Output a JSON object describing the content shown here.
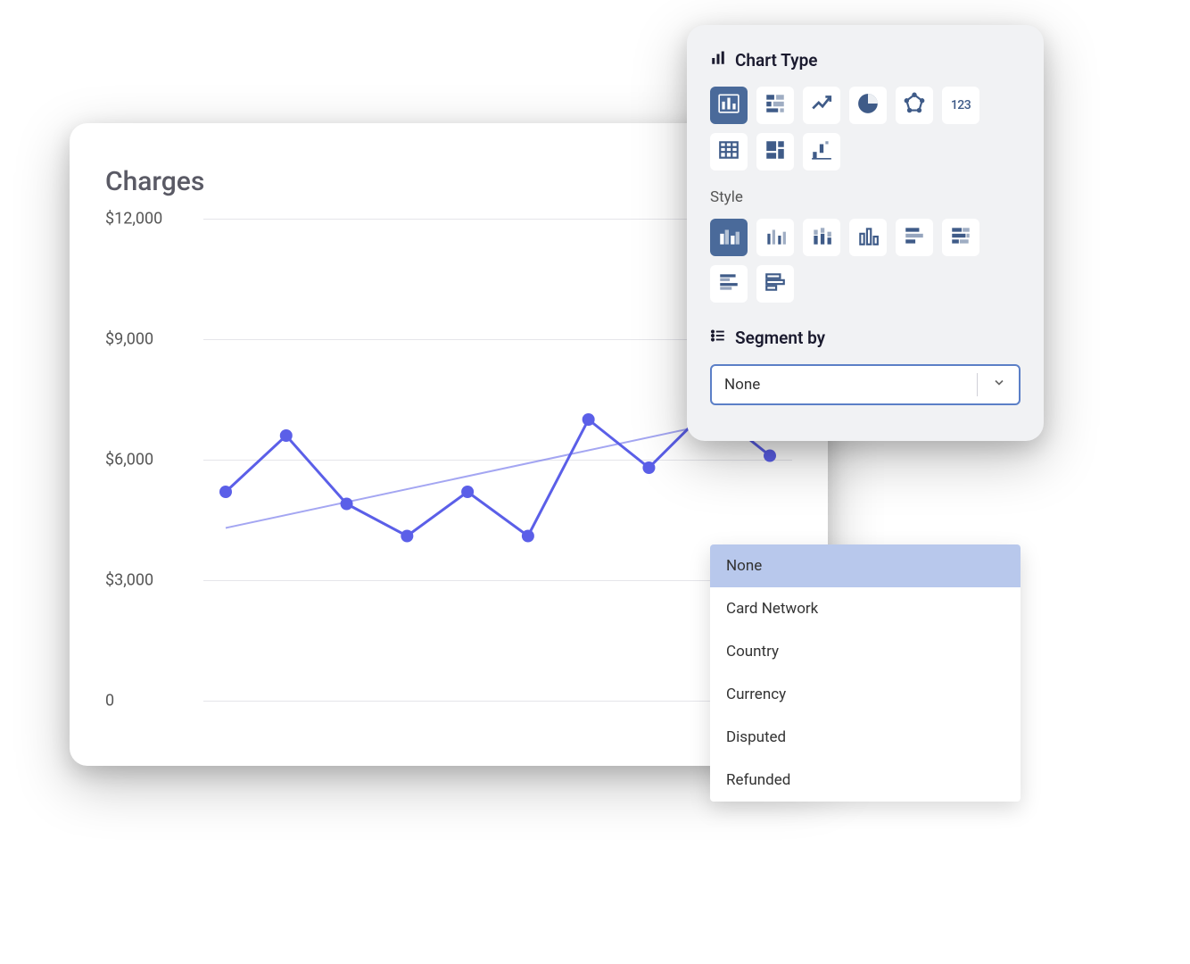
{
  "chart": {
    "title": "Charges",
    "y_ticks": [
      "$12,000",
      "$9,000",
      "$6,000",
      "$3,000",
      "0"
    ],
    "y_values": [
      12000,
      9000,
      6000,
      3000,
      0
    ]
  },
  "chart_data": {
    "type": "line",
    "title": "Charges",
    "ylabel": "",
    "xlabel": "",
    "ylim": [
      0,
      12000
    ],
    "x": [
      0,
      1,
      2,
      3,
      4,
      5,
      6,
      7,
      8,
      9
    ],
    "values": [
      5200,
      6600,
      4900,
      4100,
      5200,
      4100,
      7000,
      5800,
      7300,
      6100
    ],
    "trendline": {
      "start": 4300,
      "end": 7200
    }
  },
  "panel": {
    "chart_type_label": "Chart Type",
    "style_label": "Style",
    "segment_label": "Segment by",
    "chart_types": [
      {
        "name": "bar",
        "selected": true
      },
      {
        "name": "stacked-bar",
        "selected": false
      },
      {
        "name": "line",
        "selected": false
      },
      {
        "name": "pie",
        "selected": false
      },
      {
        "name": "radar",
        "selected": false
      },
      {
        "name": "number",
        "selected": false,
        "label": "123"
      },
      {
        "name": "table",
        "selected": false
      },
      {
        "name": "treemap",
        "selected": false
      },
      {
        "name": "waterfall",
        "selected": false
      }
    ],
    "styles": [
      {
        "name": "grouped-vertical",
        "selected": true
      },
      {
        "name": "separated-vertical",
        "selected": false
      },
      {
        "name": "stacked-vertical",
        "selected": false
      },
      {
        "name": "outlined-vertical",
        "selected": false
      },
      {
        "name": "horizontal-a",
        "selected": false
      },
      {
        "name": "horizontal-b",
        "selected": false
      },
      {
        "name": "horizontal-c",
        "selected": false
      },
      {
        "name": "horizontal-d",
        "selected": false
      }
    ],
    "segment": {
      "selected": "None",
      "options": [
        "None",
        "Card Network",
        "Country",
        "Currency",
        "Disputed",
        "Refunded"
      ]
    }
  },
  "colors": {
    "accent": "#5b5fe8",
    "panel_accent": "#4a6a9a"
  }
}
